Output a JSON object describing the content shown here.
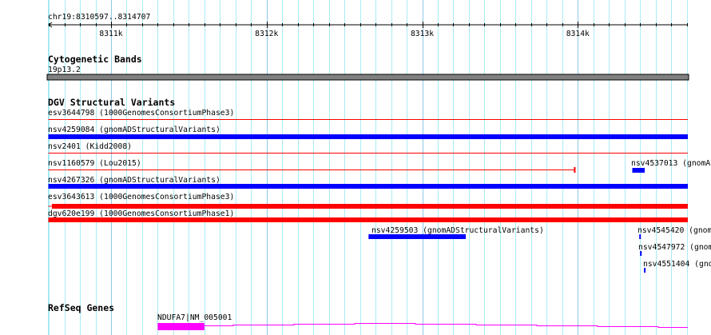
{
  "ruler": {
    "region": "chr19:8310597..8314707",
    "start": 8310597,
    "end": 8314707,
    "ticks": [
      {
        "pos": 8311000,
        "label": "8311k"
      },
      {
        "pos": 8312000,
        "label": "8312k"
      },
      {
        "pos": 8313000,
        "label": "8313k"
      },
      {
        "pos": 8314000,
        "label": "8314k"
      }
    ]
  },
  "cytoband": {
    "title": "Cytogenetic Bands",
    "band": "19p13.2",
    "color": "#808080"
  },
  "dgv": {
    "title": "DGV Structural Variants",
    "colors": {
      "gain": "#0000ff",
      "loss": "#ff0000"
    },
    "features": [
      {
        "label": "esv3644798 (1000GenomesConsortiumPhase3)",
        "start": 8310597,
        "end": 8314707,
        "style": "thin",
        "color": "#ff0000"
      },
      {
        "label": "nsv4259084 (gnomADStructuralVariants)",
        "start": 8310597,
        "end": 8314707,
        "style": "thick",
        "color": "#0000ff"
      },
      {
        "label": "nsv2401 (Kidd2008)",
        "start": 8310597,
        "end": 8314707,
        "style": "thin",
        "color": "#ff0000"
      },
      {
        "label": "nsv1160579 (Lou2015)",
        "start": 8310597,
        "end": 8313980,
        "style": "thin-end",
        "color": "#ff0000"
      },
      {
        "label": "nsv4537013 (gnomA",
        "start": 8314350,
        "end": 8314430,
        "style": "thick",
        "color": "#0000ff"
      },
      {
        "label": "nsv4267326 (gnomADStructuralVariants)",
        "start": 8310597,
        "end": 8314707,
        "style": "thick",
        "color": "#0000ff"
      },
      {
        "label": "esv3643613 (1000GenomesConsortiumPhase3)",
        "start": 8310597,
        "end": 8314707,
        "thickStart": 8310620,
        "style": "thin-thick",
        "color": "#ff0000"
      },
      {
        "label": "dgv620e199 (1000GenomesConsortiumPhase1)",
        "start": 8310597,
        "end": 8314707,
        "style": "thick",
        "color": "#ff0000"
      },
      {
        "label": "nsv4259503 (gnomADStructuralVariants)",
        "start": 8312655,
        "end": 8313280,
        "style": "thick",
        "color": "#0000ff"
      },
      {
        "label": "nsv4545420 (gnom",
        "start": 8314395,
        "end": 8314405,
        "style": "thick",
        "color": "#0000ff"
      },
      {
        "label": "nsv4547972 (gnom",
        "start": 8314400,
        "end": 8314410,
        "style": "thick",
        "color": "#0000ff"
      },
      {
        "label": "nsv4551404 (gno",
        "start": 8314425,
        "end": 8314435,
        "style": "thick",
        "color": "#0000ff"
      }
    ]
  },
  "refseq": {
    "title": "RefSeq Genes",
    "color": "#ff00ff",
    "gene": {
      "label": "NDUFA7|NM_005001",
      "exonStart": 8311300,
      "exonEnd": 8311600,
      "end": 8314707
    }
  }
}
